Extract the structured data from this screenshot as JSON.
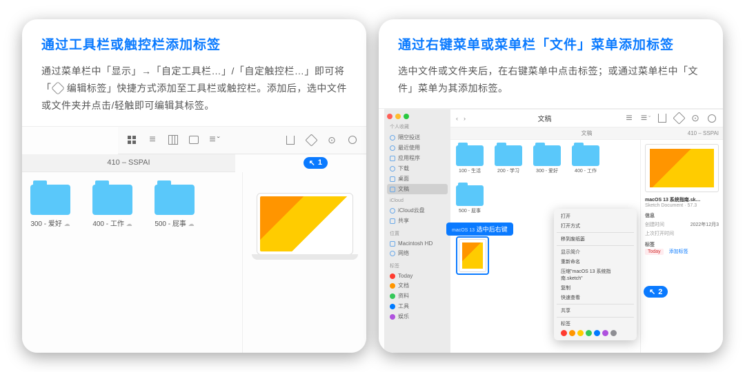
{
  "card1": {
    "title": "通过工具栏或触控栏添加标签",
    "desc_a": "通过菜单栏中「显示」→「自定工具栏…」/「自定触控栏…」即可将「",
    "desc_b": " 编辑标签」快捷方式添加至工具栏或触控栏。添加后，选中文件或文件夹并点击/轻触即可编辑其标签。",
    "path": "410 – SSPAI",
    "callout": "1",
    "folders": [
      {
        "name": "300 - 爱好"
      },
      {
        "name": "400 - 工作"
      },
      {
        "name": "500 - 屁事"
      }
    ]
  },
  "card2": {
    "title": "通过右键菜单或菜单栏「文件」菜单添加标签",
    "desc": "选中文件或文件夹后，在右键菜单中点击标签；或通过菜单栏中「文件」菜单为其添加标签。",
    "win_title": "文稿",
    "path": "文稿",
    "path_r": "410 – SSPAI",
    "tip": "选中后右键",
    "tip_pre": "macOS 13",
    "callout": "2",
    "sidebar": {
      "s1": "个人收藏",
      "items1": [
        "隔空投送",
        "最近使用",
        "应用程序",
        "下载",
        "桌面",
        "文稿"
      ],
      "s2": "iCloud",
      "items2": [
        "iCloud云盘",
        "共享"
      ],
      "s3": "位置",
      "items3": [
        "Macintosh HD",
        "网络"
      ],
      "s4": "标签",
      "tags": [
        {
          "label": "Today",
          "color": "#ff3b30"
        },
        {
          "label": "文档",
          "color": "#ff9500"
        },
        {
          "label": "资料",
          "color": "#34c759"
        },
        {
          "label": "工具",
          "color": "#007aff"
        },
        {
          "label": "娱乐",
          "color": "#af52de"
        }
      ]
    },
    "folders": [
      "100 - 生活",
      "200 - 学习",
      "300 - 爱好",
      "400 - 工作",
      "500 - 屁事"
    ],
    "menu": {
      "items": [
        "打开",
        "打开方式",
        "移到废纸篓",
        "显示简介",
        "重新命名",
        "压缩\"macOS 13 系统指南.sketch\"",
        "复制",
        "快速查看",
        "共享"
      ],
      "tag_label": "标签"
    },
    "preview": {
      "name": "macOS 13 系统指南.sk…",
      "kind": "Sketch Document · 57.3",
      "info": "信息",
      "created_k": "创建时间",
      "created_v": "2022年12月3",
      "mod_k": "上次打开时间",
      "tags_k": "标签",
      "tag": "Today",
      "add": "添加标签"
    }
  }
}
